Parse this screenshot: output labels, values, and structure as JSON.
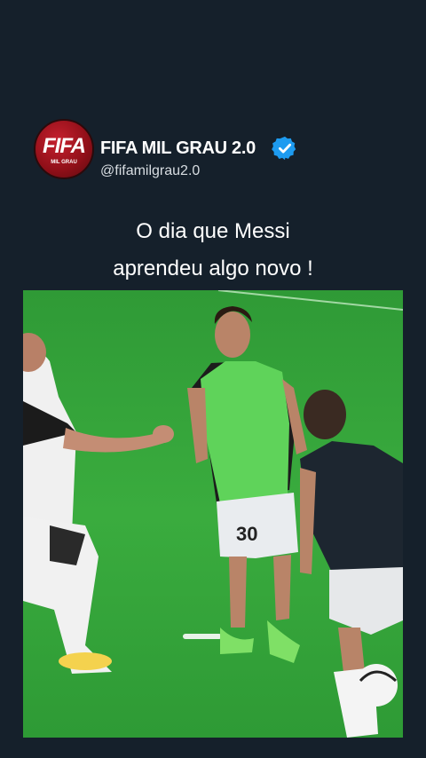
{
  "post": {
    "display_name": "FIFA MIL GRAU 2.0",
    "handle": "@fifamilgrau2.0",
    "caption_line1": "O dia que Messi",
    "caption_line2": "aprendeu algo novo !",
    "verified": true,
    "avatar_logo_text": "FIFA",
    "avatar_logo_subtext": "MIL GRAU"
  },
  "video": {
    "jersey_number": "30"
  },
  "colors": {
    "background": "#15202b",
    "verified_badge": "#1d9bf0",
    "pitch": "#37a63c",
    "bib": "#5fd35a"
  },
  "icons": [
    "verified-badge-icon"
  ]
}
